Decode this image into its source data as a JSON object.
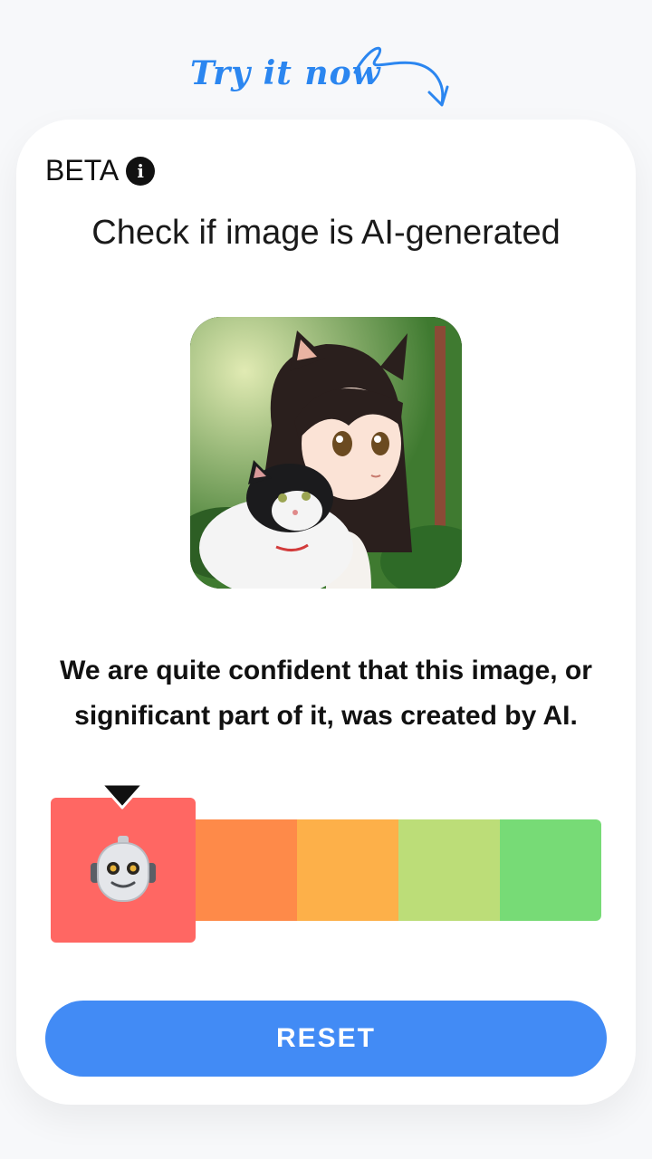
{
  "promo": {
    "label": "Try it now",
    "accent": "#2b86f0"
  },
  "card": {
    "beta_label": "BETA",
    "info_icon": "info-icon",
    "title": "Check if image is AI-generated",
    "image": {
      "subject": "anime girl with cat ears holding a black and white cat",
      "border": "#111111"
    },
    "result_text": "We are quite confident that this image, or significant part of it, was created by AI.",
    "meter": {
      "selected_index": 0,
      "selected_icon": "robot-face-icon",
      "segments": [
        {
          "color": "#ff6763"
        },
        {
          "color": "#fe8a49"
        },
        {
          "color": "#fdb049"
        },
        {
          "color": "#bcdd78"
        },
        {
          "color": "#77db76"
        }
      ]
    },
    "reset_label": "RESET",
    "reset_color": "#428bf5"
  }
}
